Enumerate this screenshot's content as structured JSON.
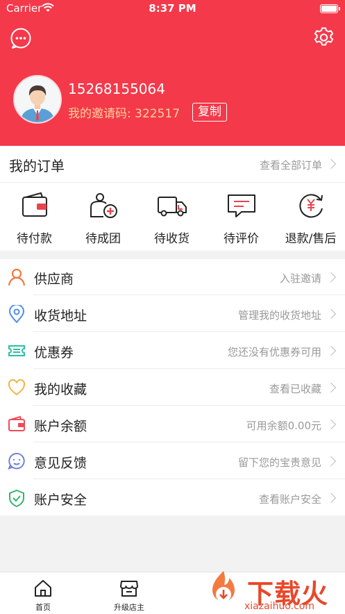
{
  "status_bar": {
    "carrier": "Carrier",
    "time": "8:37 PM"
  },
  "header": {
    "phone": "15268155064",
    "invite_text": "我的邀请码: 322517",
    "copy_label": "复制",
    "bg_color": "#f4394a"
  },
  "orders": {
    "title": "我的订单",
    "view_all": "查看全部订单",
    "items": [
      {
        "label": "待付款",
        "icon": "wallet-icon"
      },
      {
        "label": "待成团",
        "icon": "group-add-icon"
      },
      {
        "label": "待收货",
        "icon": "truck-icon"
      },
      {
        "label": "待评价",
        "icon": "comment-icon"
      },
      {
        "label": "退款/售后",
        "icon": "refund-icon"
      }
    ]
  },
  "menu": [
    {
      "label": "供应商",
      "value": "入驻邀请",
      "icon": "person-icon",
      "color": "#f07b3f"
    },
    {
      "label": "收货地址",
      "value": "管理我的收货地址",
      "icon": "location-pin-icon",
      "color": "#4d8ee8"
    },
    {
      "label": "优惠券",
      "value": "您还没有优惠券可用",
      "icon": "ticket-icon",
      "color": "#2bbfa4"
    },
    {
      "label": "我的收藏",
      "value": "查看已收藏",
      "icon": "heart-icon",
      "color": "#f2b443"
    },
    {
      "label": "账户余额",
      "value": "可用余额0.00元",
      "icon": "wallet-icon",
      "color": "#ef4b57"
    },
    {
      "label": "意见反馈",
      "value": "留下您的宝贵意见",
      "icon": "feedback-face-icon",
      "color": "#6b7fd6"
    },
    {
      "label": "账户安全",
      "value": "查看账户安全",
      "icon": "shield-check-icon",
      "color": "#33b56b"
    }
  ],
  "tabbar": [
    {
      "label": "首页",
      "icon": "home-icon"
    },
    {
      "label": "升级店主",
      "icon": "store-icon"
    }
  ],
  "watermark": {
    "text": "下载火",
    "url": "xiazaihuo.com"
  }
}
